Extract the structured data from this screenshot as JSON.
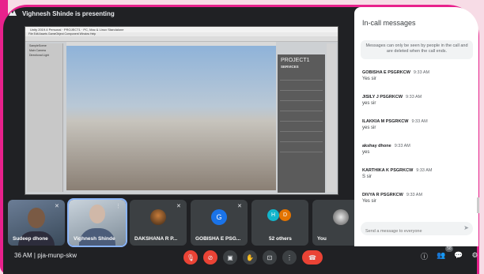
{
  "presenter": {
    "label": "Vighnesh Shinde is presenting"
  },
  "shared_screen": {
    "window_title": "Unity 2019.4 Personal · PROJECT1 · PC, Mac & Linux Standalone",
    "menu": "File  Edit  Assets  GameObject  Component  Window  Help",
    "hierarchy": [
      "SampleScene",
      "Main Camera",
      "Directional Light"
    ],
    "inspector_title": "PROJECT1",
    "inspector_sub": "SERVICES"
  },
  "participants": [
    {
      "name": "Sudeep dhone"
    },
    {
      "name": "Vighnesh Shinde"
    },
    {
      "name": "DAKSHANA R P..."
    },
    {
      "name": "GOBISHA E PSG...",
      "initial": "G"
    },
    {
      "name": "52 others",
      "initials": [
        "H",
        "D"
      ]
    },
    {
      "name": "You"
    }
  ],
  "meeting": {
    "time": "36 AM",
    "separator": "|",
    "code": "pja-munp-skw"
  },
  "badge_count": "58",
  "chat": {
    "title": "In-call messages",
    "notice": "Messages can only be seen by people in the call and are deleted when the call ends.",
    "messages": [
      {
        "sender": "GOBISHA E PSGRKCW",
        "time": "9:33 AM",
        "text": "Yes sir"
      },
      {
        "sender": "JISILY J PSGRKCW",
        "time": "9:33 AM",
        "text": "yes sir"
      },
      {
        "sender": "ILAKKIA M PSGRKCW",
        "time": "9:33 AM",
        "text": "yes sir"
      },
      {
        "sender": "akshay dhone",
        "time": "9:33 AM",
        "text": "yes"
      },
      {
        "sender": "KARTHIKA K PSGRKCW",
        "time": "9:33 AM",
        "text": "S sir"
      },
      {
        "sender": "DIVYA R PSGRKCW",
        "time": "9:33 AM",
        "text": "Yes sir"
      }
    ],
    "input_placeholder": "Send a message to everyone"
  },
  "colors": {
    "accent": "#e8218c",
    "end_call": "#ea4335",
    "background": "#202124"
  }
}
